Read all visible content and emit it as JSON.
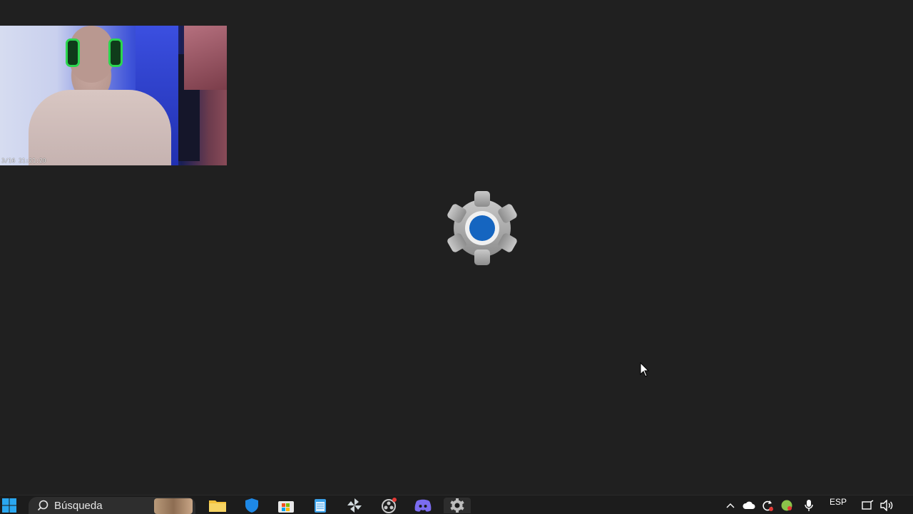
{
  "webcam": {
    "timestamp": "3/16 21:21:20"
  },
  "splash": {
    "icon": "settings-gear-icon",
    "accent": "#1565c0"
  },
  "taskbar": {
    "search": {
      "placeholder": "Búsqueda"
    },
    "apps": [
      "file-explorer-icon",
      "microsoft-defender-icon",
      "microsoft-store-icon",
      "notepad-icon",
      "pinwheel-app-icon",
      "obs-icon",
      "discord-icon",
      "settings-icon"
    ],
    "tray": {
      "language": "ESP"
    }
  }
}
